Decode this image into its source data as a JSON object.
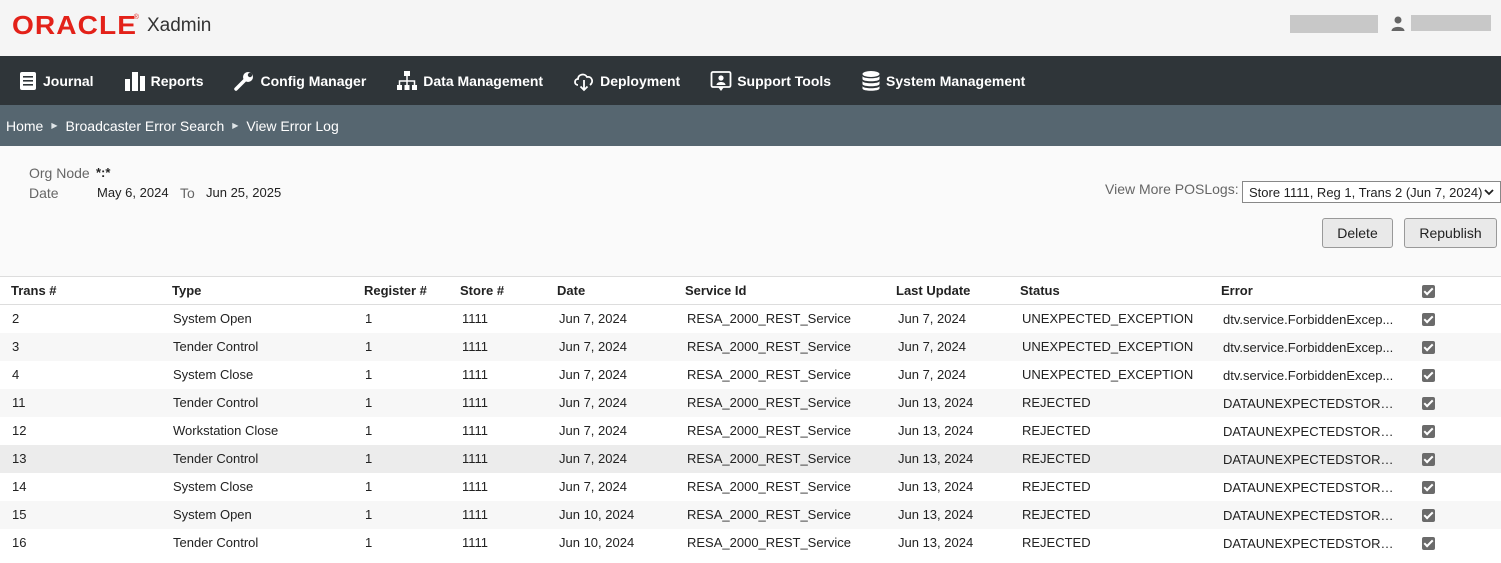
{
  "header": {
    "brand": "ORACLE",
    "app_name": "Xadmin"
  },
  "nav": {
    "items": [
      {
        "label": "Journal",
        "icon": "journal-icon"
      },
      {
        "label": "Reports",
        "icon": "bar-chart-icon"
      },
      {
        "label": "Config Manager",
        "icon": "wrench-icon"
      },
      {
        "label": "Data Management",
        "icon": "hierarchy-icon"
      },
      {
        "label": "Deployment",
        "icon": "cloud-download-icon"
      },
      {
        "label": "Support Tools",
        "icon": "support-icon"
      },
      {
        "label": "System Management",
        "icon": "database-icon"
      }
    ]
  },
  "breadcrumb": [
    "Home",
    "Broadcaster Error Search",
    "View Error Log"
  ],
  "filters": {
    "org_node_label": "Org Node",
    "org_node_value": "*:*",
    "date_label": "Date",
    "date_from": "May 6, 2024",
    "to_label": "To",
    "date_to": "Jun 25, 2025"
  },
  "view_more": {
    "label": "View More POSLogs:",
    "selected": "Store 1111, Reg 1, Trans 2 (Jun 7, 2024)"
  },
  "buttons": {
    "delete": "Delete",
    "republish": "Republish"
  },
  "table": {
    "columns": [
      "Trans #",
      "Type",
      "Register #",
      "Store #",
      "Date",
      "Service Id",
      "Last Update",
      "Status",
      "Error"
    ],
    "rows": [
      {
        "trans": "2",
        "type": "System Open",
        "register": "1",
        "store": "1111",
        "date": "Jun 7, 2024",
        "service": "RESA_2000_REST_Service",
        "last_update": "Jun 7, 2024",
        "status": "UNEXPECTED_EXCEPTION",
        "error": "dtv.service.ForbiddenExcep..."
      },
      {
        "trans": "3",
        "type": "Tender Control",
        "register": "1",
        "store": "1111",
        "date": "Jun 7, 2024",
        "service": "RESA_2000_REST_Service",
        "last_update": "Jun 7, 2024",
        "status": "UNEXPECTED_EXCEPTION",
        "error": "dtv.service.ForbiddenExcep..."
      },
      {
        "trans": "4",
        "type": "System Close",
        "register": "1",
        "store": "1111",
        "date": "Jun 7, 2024",
        "service": "RESA_2000_REST_Service",
        "last_update": "Jun 7, 2024",
        "status": "UNEXPECTED_EXCEPTION",
        "error": "dtv.service.ForbiddenExcep..."
      },
      {
        "trans": "11",
        "type": "Tender Control",
        "register": "1",
        "store": "1111",
        "date": "Jun 7, 2024",
        "service": "RESA_2000_REST_Service",
        "last_update": "Jun 13, 2024",
        "status": "REJECTED",
        "error": "DATAUNEXPECTEDSTORED..."
      },
      {
        "trans": "12",
        "type": "Workstation Close",
        "register": "1",
        "store": "1111",
        "date": "Jun 7, 2024",
        "service": "RESA_2000_REST_Service",
        "last_update": "Jun 13, 2024",
        "status": "REJECTED",
        "error": "DATAUNEXPECTEDSTORED..."
      },
      {
        "trans": "13",
        "type": "Tender Control",
        "register": "1",
        "store": "1111",
        "date": "Jun 7, 2024",
        "service": "RESA_2000_REST_Service",
        "last_update": "Jun 13, 2024",
        "status": "REJECTED",
        "error": "DATAUNEXPECTEDSTORED..."
      },
      {
        "trans": "14",
        "type": "System Close",
        "register": "1",
        "store": "1111",
        "date": "Jun 7, 2024",
        "service": "RESA_2000_REST_Service",
        "last_update": "Jun 13, 2024",
        "status": "REJECTED",
        "error": "DATAUNEXPECTEDSTORED..."
      },
      {
        "trans": "15",
        "type": "System Open",
        "register": "1",
        "store": "1111",
        "date": "Jun 10, 2024",
        "service": "RESA_2000_REST_Service",
        "last_update": "Jun 13, 2024",
        "status": "REJECTED",
        "error": "DATAUNEXPECTEDSTORED..."
      },
      {
        "trans": "16",
        "type": "Tender Control",
        "register": "1",
        "store": "1111",
        "date": "Jun 10, 2024",
        "service": "RESA_2000_REST_Service",
        "last_update": "Jun 13, 2024",
        "status": "REJECTED",
        "error": "DATAUNEXPECTEDSTORED..."
      }
    ]
  }
}
